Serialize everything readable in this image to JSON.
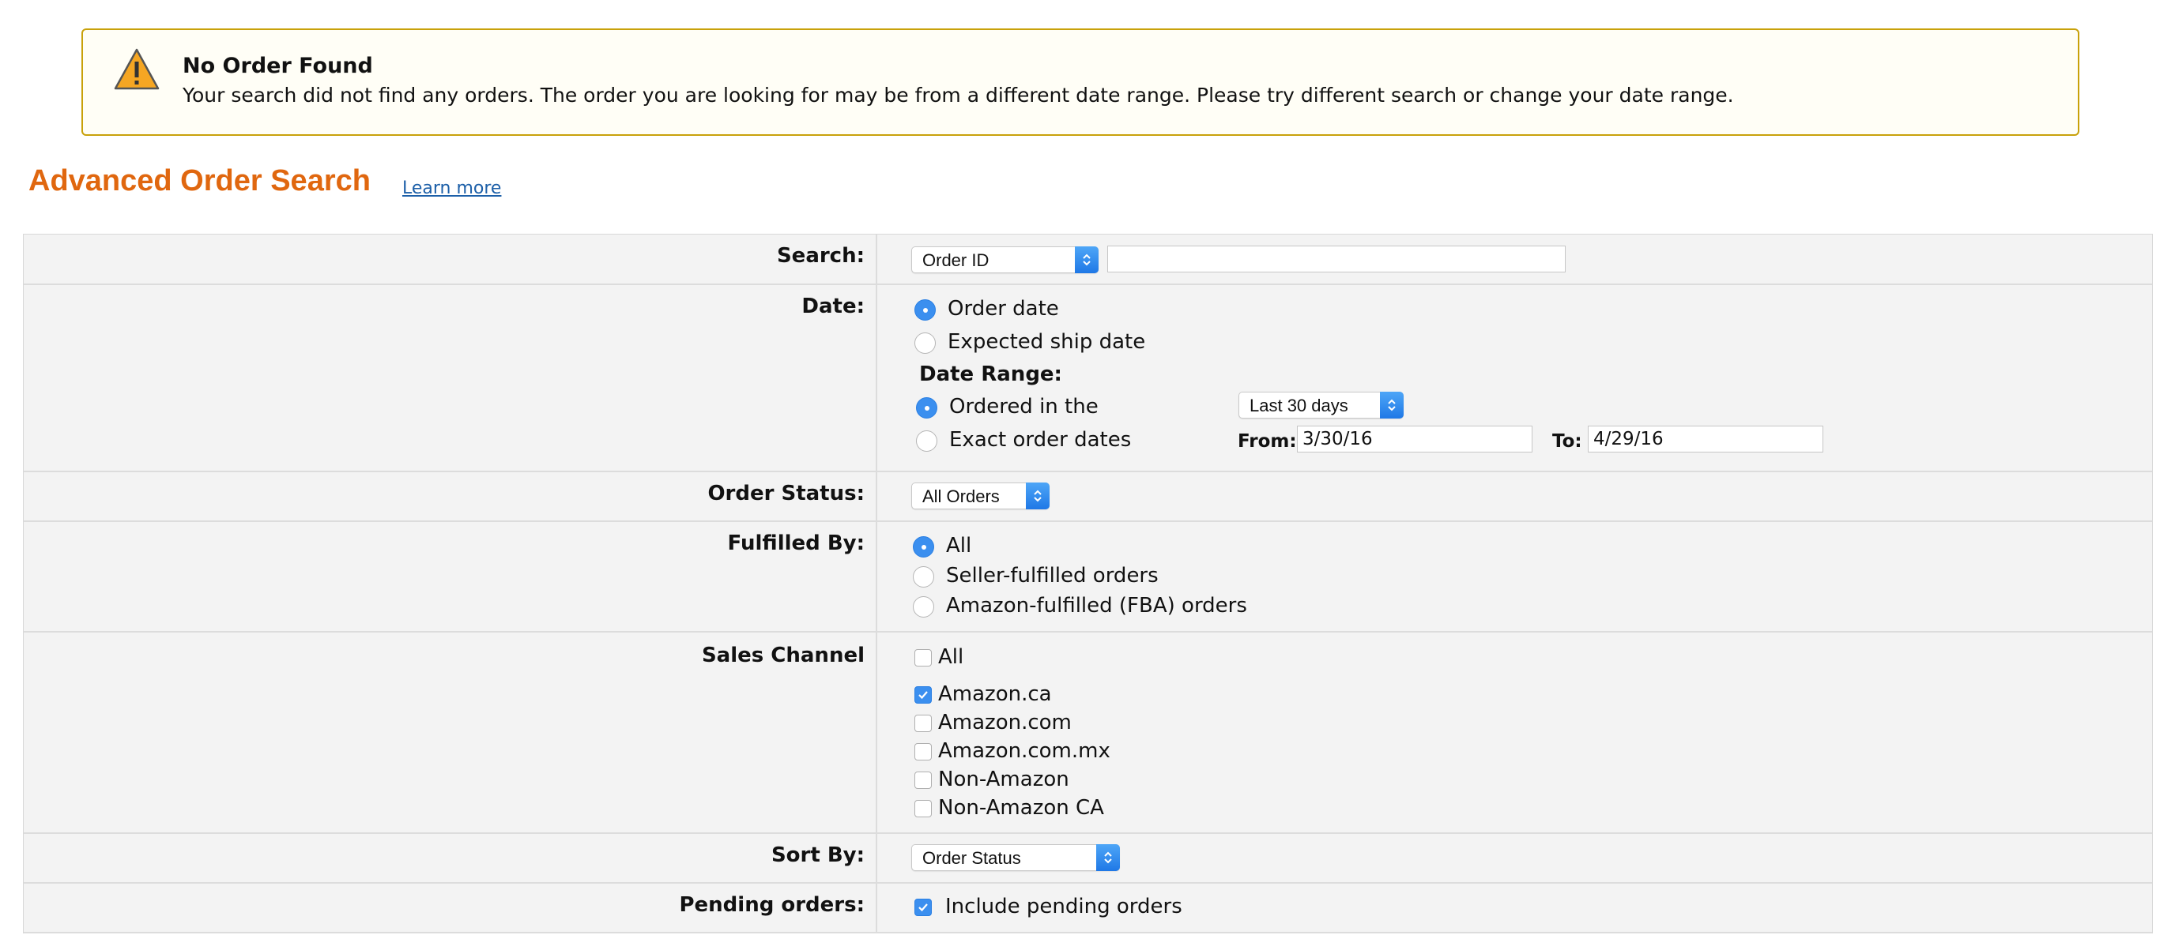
{
  "alert": {
    "icon": "warning-icon",
    "title": "No Order Found",
    "message": "Your search did not find any orders. The order you are looking for may be from a different date range. Please try different search or change your date range."
  },
  "heading": {
    "title": "Advanced Order Search",
    "learn_more": "Learn more"
  },
  "form": {
    "search": {
      "label": "Search:",
      "select_value": "Order ID",
      "input_value": ""
    },
    "date": {
      "label": "Date:",
      "options": [
        "Order date",
        "Expected ship date"
      ],
      "selected": "Order date",
      "range_label": "Date Range:",
      "range_options": [
        "Ordered in the",
        "Exact order dates"
      ],
      "range_selected": "Ordered in the",
      "period_value": "Last 30 days",
      "from_label": "From:",
      "from_value": "3/30/16",
      "to_label": "To:",
      "to_value": "4/29/16"
    },
    "order_status": {
      "label": "Order Status:",
      "select_value": "All Orders"
    },
    "fulfilled_by": {
      "label": "Fulfilled By:",
      "options": [
        "All",
        "Seller-fulfilled orders",
        "Amazon-fulfilled (FBA) orders"
      ],
      "selected": "All"
    },
    "sales_channel": {
      "label": "Sales Channel",
      "all_label": "All",
      "all_checked": false,
      "channels": [
        {
          "label": "Amazon.ca",
          "checked": true
        },
        {
          "label": "Amazon.com",
          "checked": false
        },
        {
          "label": "Amazon.com.mx",
          "checked": false
        },
        {
          "label": "Non-Amazon",
          "checked": false
        },
        {
          "label": "Non-Amazon CA",
          "checked": false
        }
      ]
    },
    "sort_by": {
      "label": "Sort By:",
      "select_value": "Order Status"
    },
    "pending": {
      "label": "Pending orders:",
      "checkbox_label": "Include pending orders",
      "checked": true
    }
  },
  "colors": {
    "title_orange": "#e0670f",
    "alert_border": "#c8a10a",
    "control_blue": "#3b8fef",
    "link_blue": "#1c5fa8",
    "row_bg": "#f3f3f3"
  }
}
